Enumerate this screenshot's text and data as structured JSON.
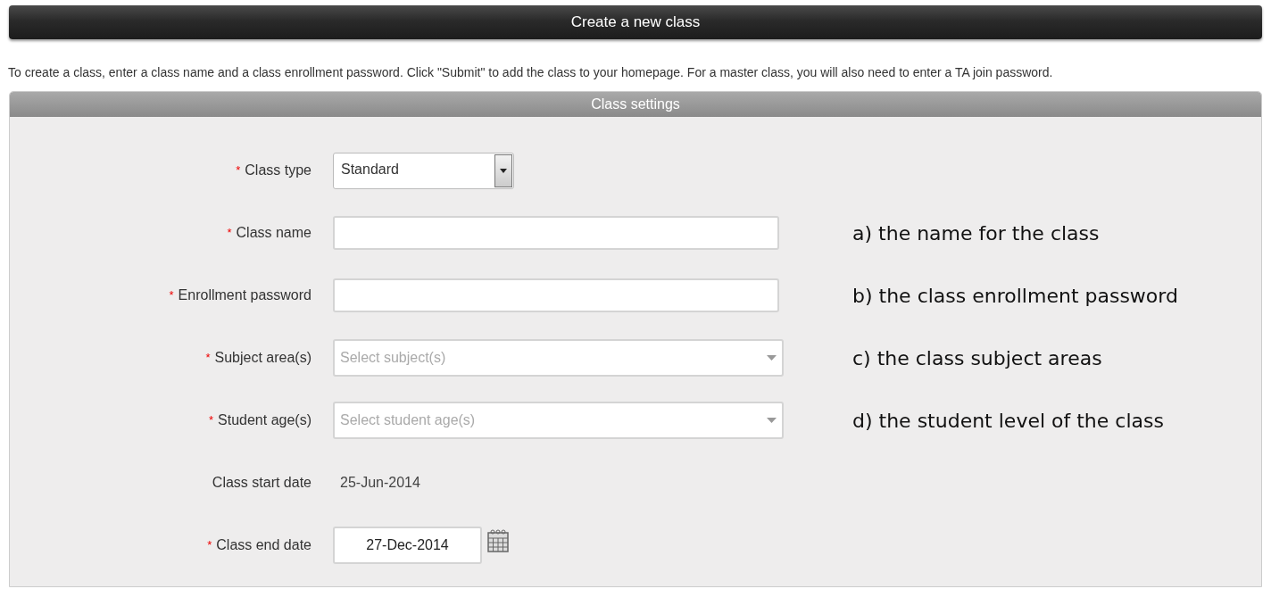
{
  "title": "Create a new class",
  "intro": "To create a class, enter a class name and a class enrollment password. Click \"Submit\" to add the class to your homepage. For a master class, you will also need to enter a TA join password.",
  "panel": {
    "title": "Class settings",
    "fields": [
      {
        "kind": "select",
        "label": "Class type",
        "required_mark": "*",
        "value": "Standard"
      },
      {
        "kind": "text",
        "label": "Class name",
        "required_mark": "*",
        "note": "a) the name for the class"
      },
      {
        "kind": "text",
        "label": "Enrollment password",
        "required_mark": "*",
        "note": "b) the class enrollment password"
      },
      {
        "kind": "multiselect",
        "label": "Subject area(s)",
        "required_mark": "*",
        "placeholder": "Select subject(s)",
        "note": "c) the class subject areas"
      },
      {
        "kind": "multiselect",
        "label": "Student age(s)",
        "required_mark": "*",
        "placeholder": "Select student age(s)",
        "note": "d) the student level of the class"
      },
      {
        "kind": "static",
        "label": "Class start date",
        "value": "25-Jun-2014"
      },
      {
        "kind": "date",
        "label": "Class end date",
        "required_mark": "*",
        "value": "27-Dec-2014"
      }
    ]
  }
}
